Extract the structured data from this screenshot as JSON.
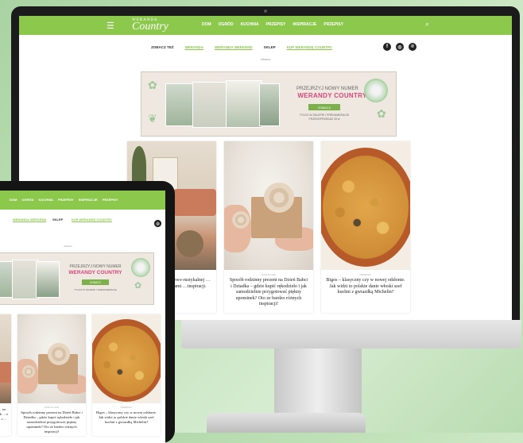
{
  "site": {
    "logo_top": "WERANDA",
    "logo": "Country",
    "nav": [
      "DOM",
      "OGRÓD",
      "KUCHNIA",
      "PRZEPISY",
      "INSPIRACJE",
      "PRZEPISY"
    ],
    "subnav": [
      "ZOBACZ TEŻ",
      "WERANDA",
      "WERANDA WEEKEND",
      "SKLEP",
      "KUP WERANDĘ COUNTRY"
    ],
    "social": [
      "f",
      "◎",
      "℗"
    ],
    "ad_label": "reklama"
  },
  "banner": {
    "kicker": "PRZEJRZYJ NOWY NUMER",
    "brand": "WERANDY COUNTRY",
    "button": "ZOBACZ",
    "small_1": "TYLKO W SKLEPIE I PRENUMERACIE",
    "small_2": "PRZEDSPRZEDAŻ 49 zł"
  },
  "cards": [
    {
      "meta": "DOM",
      "text": "…zane jak dom w …ewo-rustykalnej …kusi swoimi wnętrzami …inspiracji."
    },
    {
      "meta": "DOM IN LIFE",
      "text": "Sposób rodzinny prezent na Dzień Babci i Dziadka – gdzie kupić rękodzieło i jak samodzielnie przygotować piękny upominek? Oto ze bardzo różnych inspiracji!"
    },
    {
      "meta": "PRZEPISY",
      "text": "Bigos – klasyczny czy w nowej odsłonie. Jak widzi to polskie danie włoski szef kuchni z gwiazdką Michelin?"
    }
  ],
  "tablet": {
    "nav": [
      "DOM",
      "OGRÓD",
      "KUCHNIA",
      "PRZEPISY",
      "INSPIRACJE",
      "PRZEPISY"
    ],
    "subnav": [
      "WERANDA WEEKEND",
      "SKLEP",
      "KUP WERANDĘ COUNTRY"
    ],
    "banner_kicker": "PRZEJRZYJ NOWY NUMER",
    "banner_brand": "WERANDY COUNTRY",
    "banner_button": "ZOBACZ",
    "banner_small": "TYLKO W SKLEPIE I PRENUMERACIE",
    "cards": [
      {
        "meta": "",
        "text": "…ne jak …a …r…"
      },
      {
        "meta": "DOM IN LIFE",
        "text": "Sposób rodzinny prezent na Dzień Babci i Dziadka – gdzie kupić rękodzieło i jak samodzielnie przygotować piękny upominek? Oto ze bardzo różnych inspiracji!"
      },
      {
        "meta": "PRZEPISY",
        "text": "Bigos – klasyczny czy w nowej odsłonie. Jak widzi to polskie danie włoski szef kuchni z gwiazdką Michelin?"
      }
    ]
  },
  "colors": {
    "brand_green": "#8cc84b",
    "brand_pink": "#d9447a"
  }
}
